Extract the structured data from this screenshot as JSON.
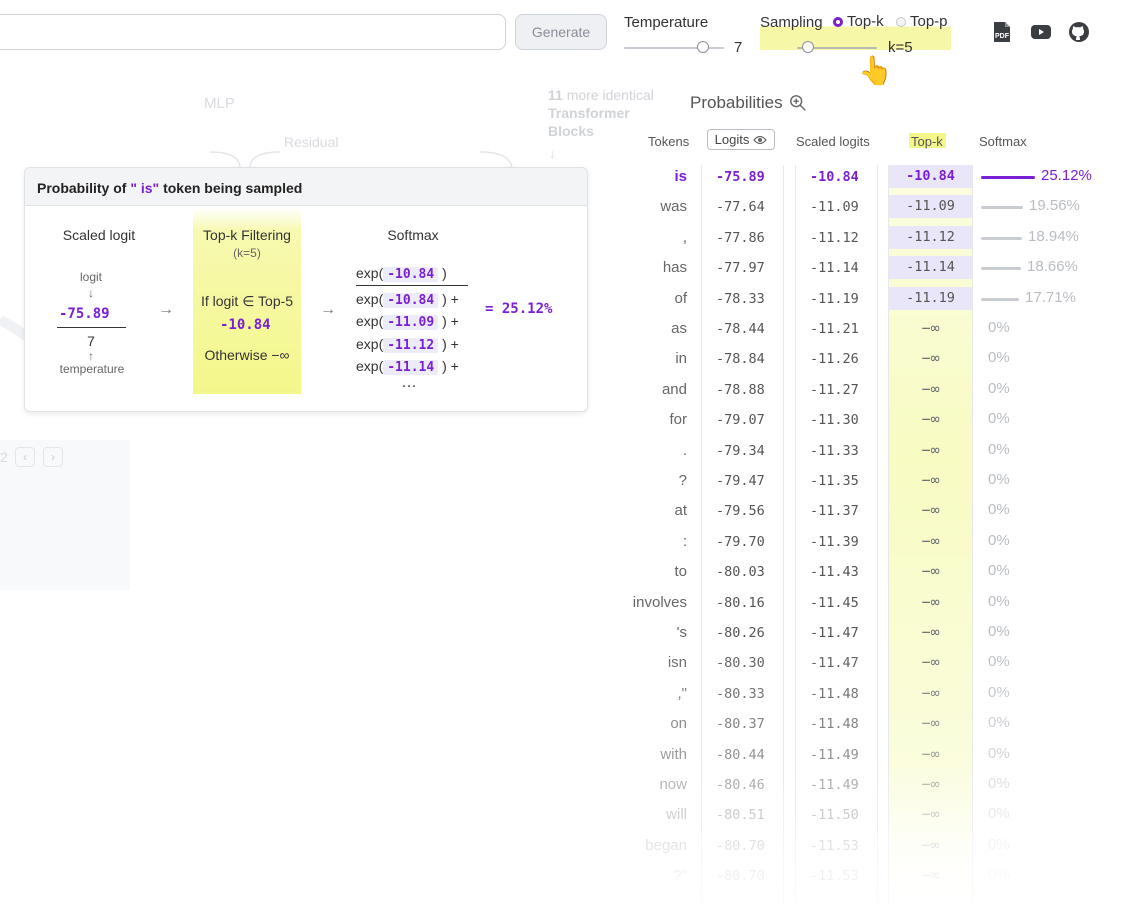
{
  "toolbar": {
    "generate_label": "Generate",
    "temperature_label": "Temperature",
    "temperature_value": "7",
    "sampling_label": "Sampling",
    "topk_label": "Top-k",
    "topp_label": "Top-p",
    "k_value": "k=5",
    "icons": [
      "pdf-icon",
      "youtube-icon",
      "github-icon"
    ]
  },
  "background": {
    "mlp": "MLP",
    "residual": "Residual",
    "blocks_count": "11",
    "blocks_text_1": "more identical",
    "blocks_text_2": "Transformer",
    "blocks_text_3": "Blocks",
    "page_num": "2"
  },
  "popup": {
    "title_prefix": "Probability of",
    "title_token": "\" is\"",
    "title_suffix": "token being sampled",
    "scaled_logit_title": "Scaled logit",
    "logit_label": "logit",
    "logit_value": "-75.89",
    "temperature_value": "7",
    "temperature_label": "temperature",
    "topk_title": "Top-k Filtering",
    "topk_sub": "(k=5)",
    "if_text": "If logit ∈ Top-5",
    "if_value": "-10.84",
    "otherwise_text": "Otherwise −∞",
    "softmax_title": "Softmax",
    "numerator_value": "-10.84",
    "denominator_values": [
      "-10.84",
      "-11.09",
      "-11.12",
      "-11.14"
    ],
    "ellipsis": "…",
    "result": "= 25.12%"
  },
  "table": {
    "title": "Probabilities",
    "headers": {
      "tokens": "Tokens",
      "logits": "Logits",
      "scaled": "Scaled logits",
      "topk": "Top-k",
      "softmax": "Softmax"
    },
    "rows": [
      {
        "token": "is",
        "logit": "-75.89",
        "scaled": "-10.84",
        "topk": "-10.84",
        "prob": "25.12%",
        "p": 0.2512
      },
      {
        "token": "was",
        "logit": "-77.64",
        "scaled": "-11.09",
        "topk": "-11.09",
        "prob": "19.56%",
        "p": 0.1956
      },
      {
        "token": ",",
        "logit": "-77.86",
        "scaled": "-11.12",
        "topk": "-11.12",
        "prob": "18.94%",
        "p": 0.1894
      },
      {
        "token": "has",
        "logit": "-77.97",
        "scaled": "-11.14",
        "topk": "-11.14",
        "prob": "18.66%",
        "p": 0.1866
      },
      {
        "token": "of",
        "logit": "-78.33",
        "scaled": "-11.19",
        "topk": "-11.19",
        "prob": "17.71%",
        "p": 0.1771
      },
      {
        "token": "as",
        "logit": "-78.44",
        "scaled": "-11.21",
        "topk": "−∞",
        "prob": "0%",
        "p": 0
      },
      {
        "token": "in",
        "logit": "-78.84",
        "scaled": "-11.26",
        "topk": "−∞",
        "prob": "0%",
        "p": 0
      },
      {
        "token": "and",
        "logit": "-78.88",
        "scaled": "-11.27",
        "topk": "−∞",
        "prob": "0%",
        "p": 0
      },
      {
        "token": "for",
        "logit": "-79.07",
        "scaled": "-11.30",
        "topk": "−∞",
        "prob": "0%",
        "p": 0
      },
      {
        "token": ".",
        "logit": "-79.34",
        "scaled": "-11.33",
        "topk": "−∞",
        "prob": "0%",
        "p": 0
      },
      {
        "token": "?",
        "logit": "-79.47",
        "scaled": "-11.35",
        "topk": "−∞",
        "prob": "0%",
        "p": 0
      },
      {
        "token": "at",
        "logit": "-79.56",
        "scaled": "-11.37",
        "topk": "−∞",
        "prob": "0%",
        "p": 0
      },
      {
        "token": ":",
        "logit": "-79.70",
        "scaled": "-11.39",
        "topk": "−∞",
        "prob": "0%",
        "p": 0
      },
      {
        "token": "to",
        "logit": "-80.03",
        "scaled": "-11.43",
        "topk": "−∞",
        "prob": "0%",
        "p": 0
      },
      {
        "token": "involves",
        "logit": "-80.16",
        "scaled": "-11.45",
        "topk": "−∞",
        "prob": "0%",
        "p": 0
      },
      {
        "token": "'s",
        "logit": "-80.26",
        "scaled": "-11.47",
        "topk": "−∞",
        "prob": "0%",
        "p": 0
      },
      {
        "token": "isn",
        "logit": "-80.30",
        "scaled": "-11.47",
        "topk": "−∞",
        "prob": "0%",
        "p": 0
      },
      {
        "token": ",\"",
        "logit": "-80.33",
        "scaled": "-11.48",
        "topk": "−∞",
        "prob": "0%",
        "p": 0
      },
      {
        "token": "on",
        "logit": "-80.37",
        "scaled": "-11.48",
        "topk": "−∞",
        "prob": "0%",
        "p": 0
      },
      {
        "token": "with",
        "logit": "-80.44",
        "scaled": "-11.49",
        "topk": "−∞",
        "prob": "0%",
        "p": 0
      },
      {
        "token": "now",
        "logit": "-80.46",
        "scaled": "-11.49",
        "topk": "−∞",
        "prob": "0%",
        "p": 0
      },
      {
        "token": "will",
        "logit": "-80.51",
        "scaled": "-11.50",
        "topk": "−∞",
        "prob": "0%",
        "p": 0
      },
      {
        "token": "began",
        "logit": "-80.70",
        "scaled": "-11.53",
        "topk": "−∞",
        "prob": "0%",
        "p": 0
      },
      {
        "token": "?\"",
        "logit": "-80.70",
        "scaled": "-11.53",
        "topk": "−∞",
        "prob": "0%",
        "p": 0
      }
    ]
  },
  "colors": {
    "accent": "#7a1fd6",
    "highlight": "#f3f78a",
    "chip": "#e8e6f8"
  }
}
